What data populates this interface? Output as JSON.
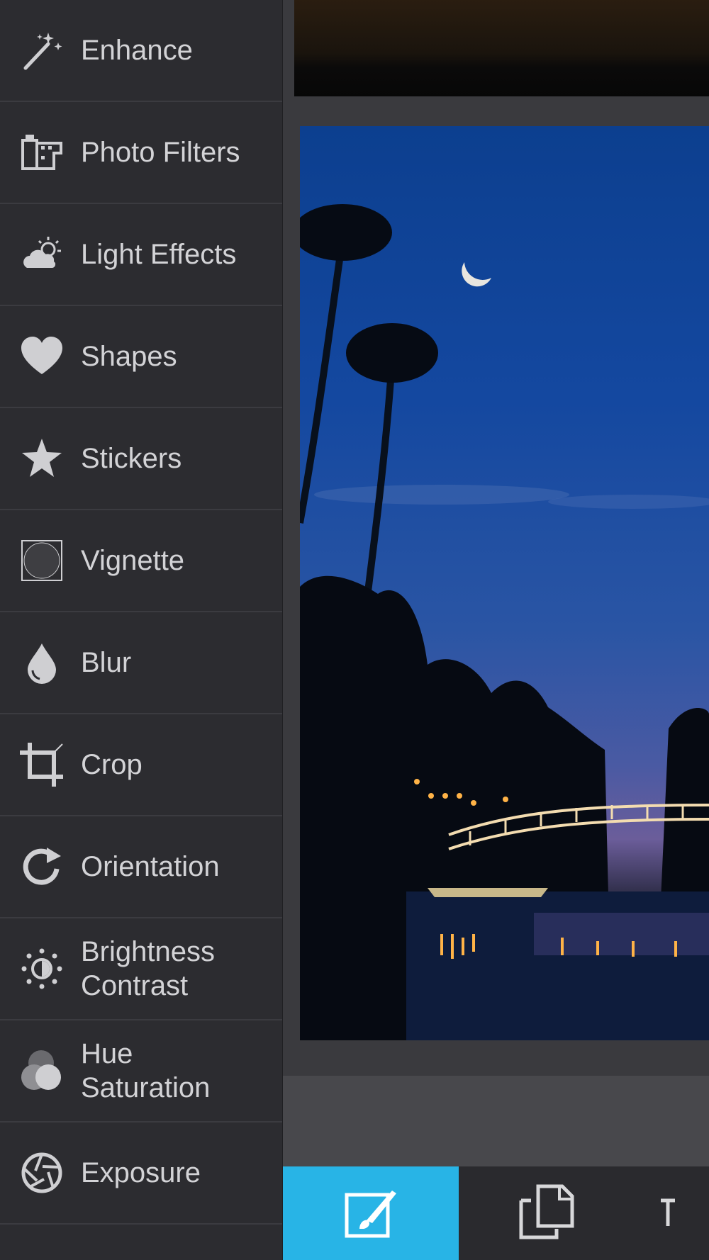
{
  "sidebar": {
    "items": [
      {
        "label": "Enhance",
        "icon": "magic-wand-icon"
      },
      {
        "label": "Photo Filters",
        "icon": "film-filter-icon"
      },
      {
        "label": "Light Effects",
        "icon": "cloud-sun-icon"
      },
      {
        "label": "Shapes",
        "icon": "heart-icon"
      },
      {
        "label": "Stickers",
        "icon": "star-icon"
      },
      {
        "label": "Vignette",
        "icon": "vignette-icon"
      },
      {
        "label": "Blur",
        "icon": "drop-icon"
      },
      {
        "label": "Crop",
        "icon": "crop-icon"
      },
      {
        "label": "Orientation",
        "icon": "rotate-icon"
      },
      {
        "label": "Brightness\nContrast",
        "icon": "brightness-icon"
      },
      {
        "label": "Hue\nSaturation",
        "icon": "hue-circles-icon"
      },
      {
        "label": "Exposure",
        "icon": "aperture-icon"
      }
    ]
  },
  "toolbar": {
    "buttons": [
      {
        "icon": "edit-brush-icon",
        "active": true
      },
      {
        "icon": "copy-documents-icon",
        "active": false
      },
      {
        "icon": "more-icon",
        "active": false
      }
    ],
    "active_color": "#28b4e6"
  }
}
